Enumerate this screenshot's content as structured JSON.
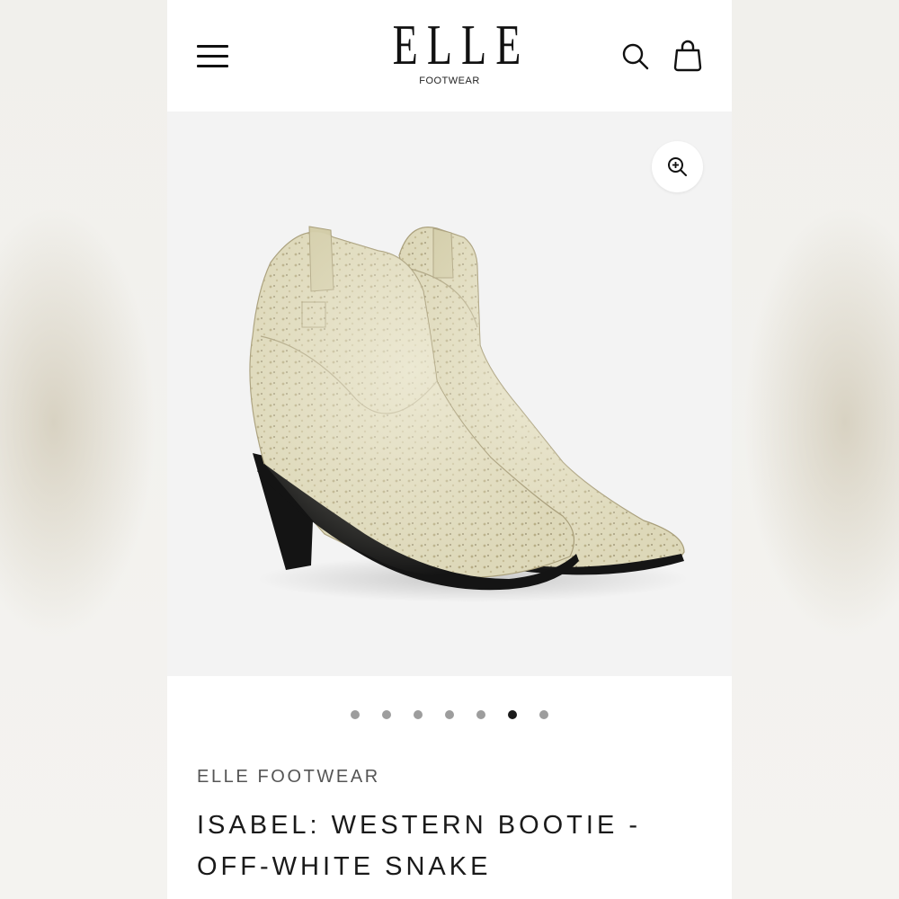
{
  "header": {
    "logo_text": "ELLE",
    "logo_subtext": "FOOTWEAR",
    "menu_icon": "hamburger-menu-icon",
    "search_icon": "search-icon",
    "cart_icon": "shopping-bag-icon"
  },
  "gallery": {
    "zoom_icon": "zoom-in-icon",
    "image_alt": "Isabel western bootie, off-white snake print",
    "slide_count": 7,
    "active_slide": 6
  },
  "product": {
    "vendor": "ELLE FOOTWEAR",
    "title": "ISABEL: WESTERN BOOTIE - OFF-WHITE SNAKE"
  },
  "colors": {
    "accent": "#1b1b1b",
    "dot_inactive": "#9d9d9d",
    "boot": "#ddd8b9",
    "sole": "#151515"
  }
}
